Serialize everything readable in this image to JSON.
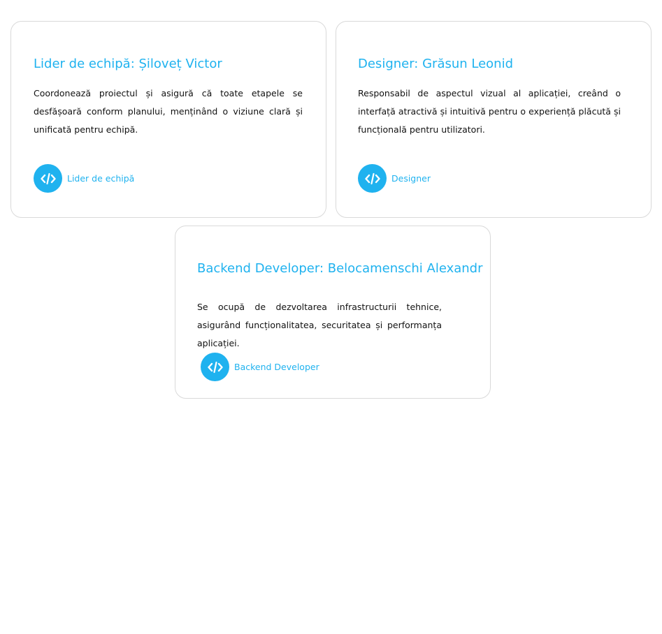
{
  "cards": {
    "lead": {
      "title": "Lider de echipă: Șiloveț Victor",
      "description": "Coordonează proiectul și asigură că toate etapele se desfășoară conform planului, menținând o viziune clară și unificată pentru echipă.",
      "role_label": "Lider de echipă",
      "icon": "code-icon"
    },
    "designer": {
      "title": "Designer: Grăsun Leonid",
      "description": "Responsabil de aspectul vizual al aplicației, creând o interfață atractivă și intuitivă pentru o experiență plăcută și funcțională pentru utilizatori.",
      "role_label": "Designer",
      "icon": "code-icon"
    },
    "backend": {
      "title": "Backend Developer: Belocamenschi Alexandr",
      "description": "Se ocupă de dezvoltarea infrastructurii tehnice, asigurând funcționalitatea, securitatea și performanța aplicației.",
      "role_label": "Backend Developer",
      "icon": "code-icon"
    }
  },
  "colors": {
    "accent": "#1fb2ef",
    "text": "#111111",
    "border": "#d9d9d9",
    "background": "#ffffff"
  }
}
